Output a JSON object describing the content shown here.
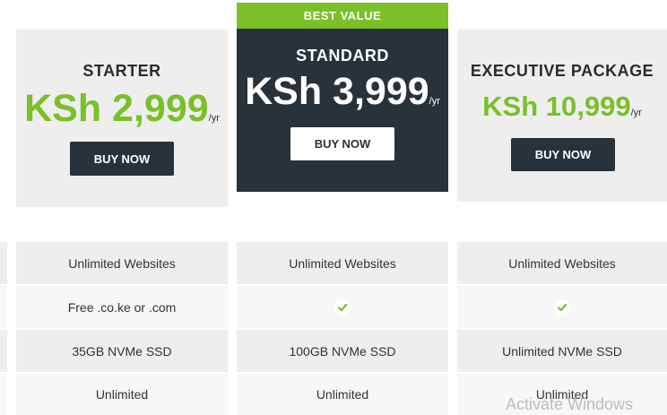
{
  "badge": "BEST VALUE",
  "plans": [
    {
      "name": "STARTER",
      "price": "KSh 2,999",
      "period": "/yr",
      "button": "BUY NOW"
    },
    {
      "name": "STANDARD",
      "price": "KSh 3,999",
      "period": "/yr",
      "button": "BUY NOW"
    },
    {
      "name": "EXECUTIVE PACKAGE",
      "price": "KSh 10,999",
      "period": "/yr",
      "button": "BUY NOW"
    }
  ],
  "features": [
    {
      "starter": "Unlimited Websites",
      "standard": "Unlimited Websites",
      "executive": "Unlimited Websites"
    },
    {
      "starter": "Free .co.ke or .com",
      "standard_icon": "check-icon",
      "executive_icon": "check-icon"
    },
    {
      "starter": "35GB NVMe SSD",
      "standard": "100GB NVMe SSD",
      "executive": "Unlimited NVMe SSD"
    },
    {
      "starter": "Unlimited",
      "standard": "Unlimited",
      "executive": "Unlimited"
    }
  ],
  "watermark": "Activate Windows",
  "colors": {
    "accent": "#7ac028",
    "dark": "#27323b",
    "card": "#eeeeee"
  }
}
